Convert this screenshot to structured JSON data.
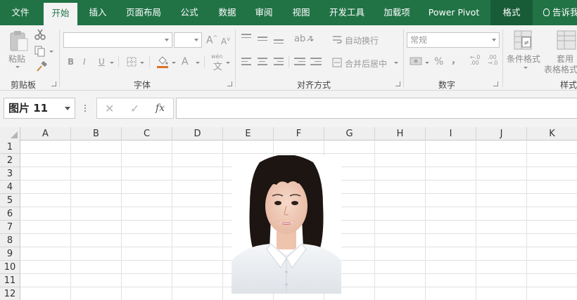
{
  "ribbon_tabs": [
    {
      "label": "文件"
    },
    {
      "label": "开始"
    },
    {
      "label": "插入"
    },
    {
      "label": "页面布局"
    },
    {
      "label": "公式"
    },
    {
      "label": "数据"
    },
    {
      "label": "审阅"
    },
    {
      "label": "视图"
    },
    {
      "label": "开发工具"
    },
    {
      "label": "加载项"
    },
    {
      "label": "Power Pivot"
    },
    {
      "label": "格式"
    }
  ],
  "tell_me": "告诉我",
  "groups": {
    "clipboard": {
      "label": "剪贴板",
      "paste": "粘贴"
    },
    "font": {
      "label": "字体",
      "bold": "B",
      "italic": "I",
      "underline": "U",
      "font_color": "A",
      "phonetic": "wén"
    },
    "alignment": {
      "label": "对齐方式",
      "wrap_text": "自动换行",
      "merge_center": "合并后居中"
    },
    "number": {
      "label": "数字",
      "format": "常规",
      "percent": "%",
      "comma": ","
    },
    "styles": {
      "label": "样式",
      "conditional_format": "条件格式",
      "format_table_1": "套用",
      "format_table_2": "表格格式"
    }
  },
  "formula_bar": {
    "name_box": "图片 11",
    "cancel": "✕",
    "enter": "✓",
    "fx": "fx",
    "value": ""
  },
  "columns": [
    "A",
    "B",
    "C",
    "D",
    "E",
    "F",
    "G",
    "H",
    "I",
    "J",
    "K"
  ],
  "rows": [
    "1",
    "2",
    "3",
    "4",
    "5",
    "6",
    "7",
    "8",
    "9",
    "10",
    "11",
    "12"
  ],
  "colors": {
    "brand": "#217346",
    "active_tab_bg": "#f3f3f3",
    "ribbon_bg": "#f3f3f3",
    "header_bg": "#efefef",
    "fill_accent": "#e2702a"
  },
  "icons": {
    "paste": "clipboard-paste-icon",
    "cut": "scissors-icon",
    "copy": "copy-icon",
    "format_painter": "paintbrush-icon",
    "border": "border-icon",
    "fill": "paint-bucket-icon",
    "lightbulb": "lightbulb-icon"
  }
}
